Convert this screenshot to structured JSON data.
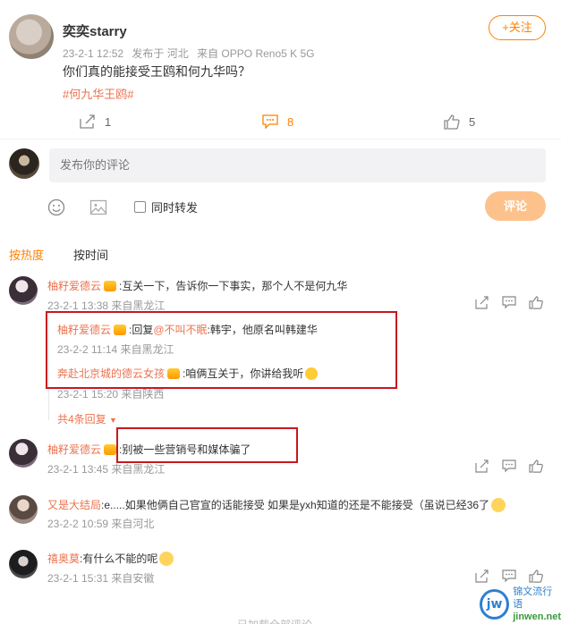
{
  "post": {
    "author": "奕奕starry",
    "follow_label": "+关注",
    "date": "23-2-1 12:52",
    "location": "发布于 河北",
    "device": "来自 OPPO Reno5 K 5G",
    "text": "你们真的能接受王鸥和何九华吗？",
    "hashtag": "#何九华王鸥#",
    "shares": "1",
    "comments": "8",
    "likes": "5"
  },
  "composer": {
    "placeholder": "发布你的评论",
    "repost_label": "同时转发",
    "submit_label": "评论"
  },
  "sort": {
    "hot": "按热度",
    "time": "按时间"
  },
  "comments": [
    {
      "user": "柚籽爱德云",
      "text": ":互关一下，告诉你一下事实，那个人不是何九华",
      "meta": "23-2-1 13:38 来自黑龙江",
      "replies": [
        {
          "user": "柚籽爱德云",
          "prefix": ":回复",
          "mention": "@不叫不眠",
          "text": ":韩宇，他原名叫韩建华",
          "meta": "23-2-2 11:14 来自黑龙江"
        },
        {
          "user": "奔赴北京城的德云女孩",
          "text": ":咱俩互关于，你讲给我听",
          "meta": "23-2-1 15:20 来自陕西"
        }
      ],
      "more": "共4条回复"
    },
    {
      "user": "柚籽爱德云",
      "text": ":别被一些营销号和媒体骗了",
      "meta": "23-2-1 13:45 来自黑龙江"
    },
    {
      "user": "又是大结局",
      "text": ":e.....如果他俩自己官宣的话能接受 如果是yxh知道的还是不能接受（虽说已经36了",
      "meta": "23-2-2 10:59 来自河北"
    },
    {
      "user": "禧奥莫",
      "text": ":有什么不能的呢",
      "meta": "23-2-1 15:31 来自安徽"
    }
  ],
  "footer_hint": "已加载全部评论",
  "watermark": {
    "logo": "jw",
    "name": "锦文流行语",
    "url": "jinwen.net"
  },
  "colors": {
    "accent": "#ff8200",
    "username": "#eb7350",
    "highlight_box": "#c8171e"
  }
}
